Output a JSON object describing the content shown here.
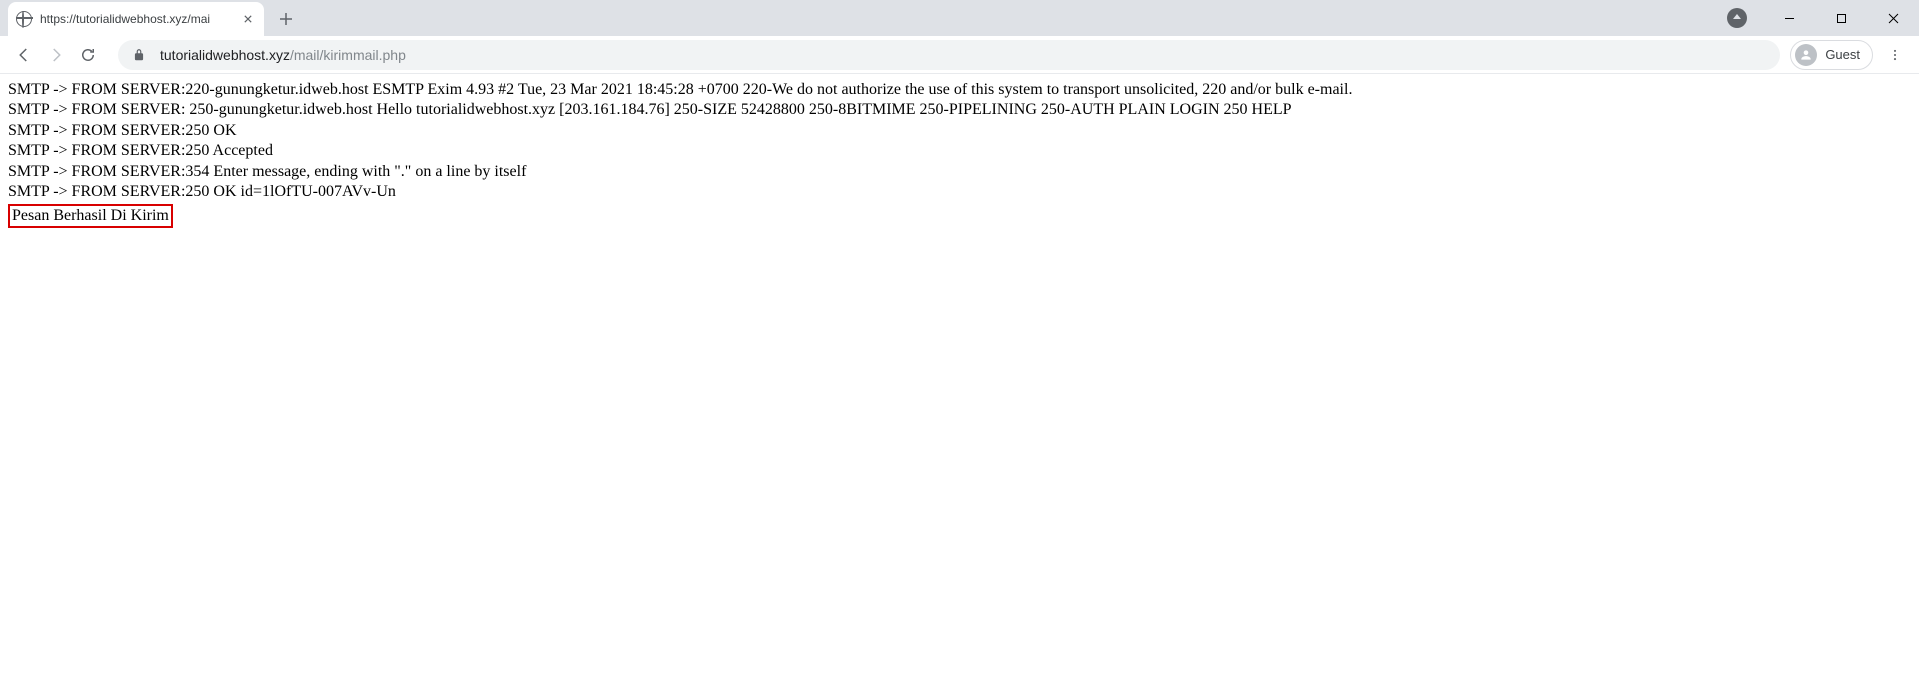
{
  "browser": {
    "tab_title": "https://tutorialidwebhost.xyz/mai",
    "url_host": "tutorialidwebhost.xyz",
    "url_path": "/mail/kirimmail.php",
    "guest_label": "Guest"
  },
  "content": {
    "lines": [
      "SMTP -> FROM SERVER:220-gunungketur.idweb.host ESMTP Exim 4.93 #2 Tue, 23 Mar 2021 18:45:28 +0700 220-We do not authorize the use of this system to transport unsolicited, 220 and/or bulk e-mail.",
      "SMTP -> FROM SERVER: 250-gunungketur.idweb.host Hello tutorialidwebhost.xyz [203.161.184.76] 250-SIZE 52428800 250-8BITMIME 250-PIPELINING 250-AUTH PLAIN LOGIN 250 HELP",
      "SMTP -> FROM SERVER:250 OK",
      "SMTP -> FROM SERVER:250 Accepted",
      "SMTP -> FROM SERVER:354 Enter message, ending with \".\" on a line by itself",
      "SMTP -> FROM SERVER:250 OK id=1lOfTU-007AVv-Un"
    ],
    "success_message": "Pesan Berhasil Di Kirim"
  }
}
